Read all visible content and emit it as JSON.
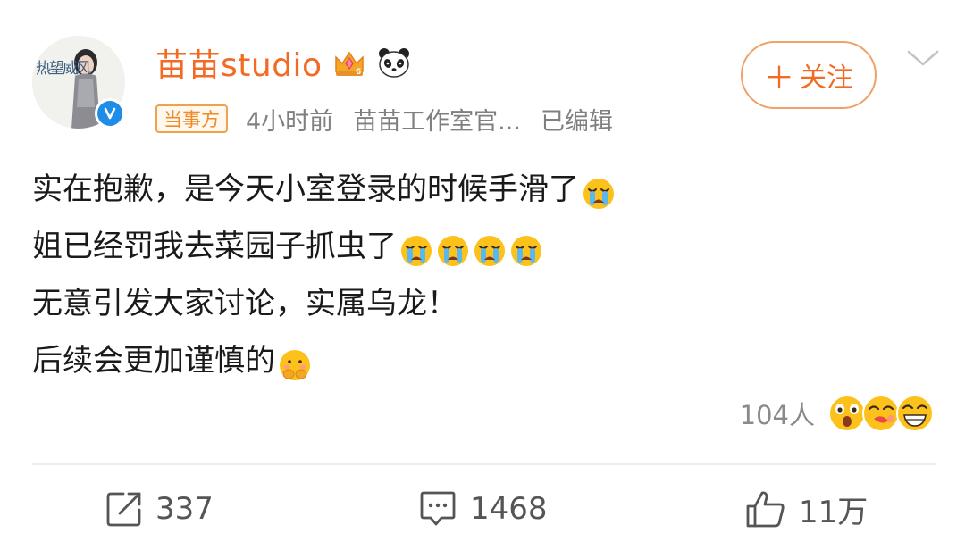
{
  "header": {
    "username": "苗苗studio",
    "avatar_text": "热望威风",
    "badges": [
      "crown-icon",
      "panda-icon"
    ],
    "verified_icon": "verified-v-icon",
    "tag": "当事方",
    "time": "4小时前",
    "source": "苗苗工作室官...",
    "edited": "已编辑",
    "follow_label": "关注",
    "menu_icon": "chevron-down-icon"
  },
  "post": {
    "lines": [
      {
        "text": "实在抱歉，是今天小室登录的时候手滑了",
        "emojis": [
          "crying-emoji"
        ]
      },
      {
        "text": "姐已经罚我去菜园子抓虫了",
        "emojis": [
          "crying-emoji",
          "crying-emoji",
          "crying-emoji",
          "crying-emoji"
        ]
      },
      {
        "text": "无意引发大家讨论，实属乌龙！",
        "emojis": []
      },
      {
        "text": "后续会更加谨慎的",
        "emojis": [
          "shy-emoji"
        ]
      }
    ]
  },
  "reactions": {
    "count": "104人",
    "emojis": [
      "surprised-emoji",
      "kiss-emoji",
      "grin-emoji"
    ]
  },
  "actions": {
    "repost": "337",
    "comment": "1468",
    "like": "11万"
  },
  "colors": {
    "brand": "#f26a24",
    "verified": "#1e8de8",
    "tag_border": "#f3a04b",
    "meta_text": "#7f7f7f"
  }
}
